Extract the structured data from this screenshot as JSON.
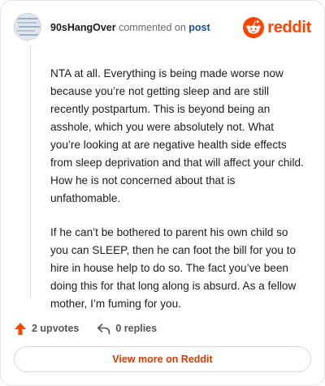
{
  "header": {
    "username": "90sHangOver",
    "action_text": "commented on",
    "post_link": "post",
    "brand_name": "reddit"
  },
  "comment": {
    "paragraphs": [
      "NTA at all. Everything is being made worse now because you’re not getting sleep and are still recently postpartum. This is beyond being an asshole, which you were absolutely not. What you’re looking at are negative health side effects from sleep deprivation and that will affect your child. How he is not concerned about that is unfathomable.",
      "If he can’t be bothered to parent his own child so you can SLEEP, then he can foot the bill for you to hire in house help to do so. The fact you’ve been doing this for that long along is absurd. As a fellow mother, I’m fuming for you."
    ]
  },
  "footer": {
    "upvotes_label": "2 upvotes",
    "replies_label": "0 replies",
    "view_more_label": "View more on Reddit"
  },
  "icons": {
    "upvote": "upvote-arrow-icon",
    "reply": "reply-arrow-icon",
    "brand": "reddit-snoo-icon"
  },
  "colors": {
    "brand": "#ff4500",
    "link": "#1a4d9c",
    "view_more": "#d93a00"
  }
}
